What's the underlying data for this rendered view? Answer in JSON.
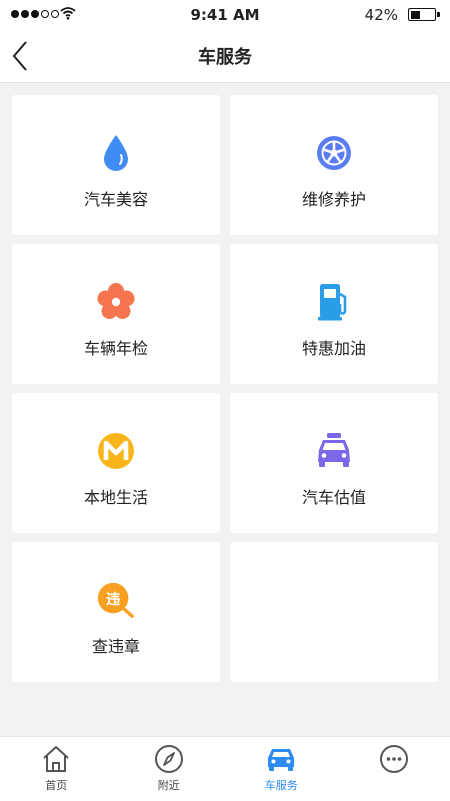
{
  "status_bar": {
    "time": "9:41 AM",
    "battery": "42%",
    "battery_level": 0.42,
    "signal_bars": 3,
    "icons": [
      "signal-icon",
      "wifi-icon",
      "battery-icon"
    ]
  },
  "nav": {
    "title": "车服务",
    "back_icon": "chevron-left-icon"
  },
  "services": [
    {
      "label": "汽车美容",
      "icon": "water-drop-icon",
      "color": "#3f8cf3"
    },
    {
      "label": "维修养护",
      "icon": "wheel-icon",
      "color": "#5b7df2"
    },
    {
      "label": "车辆年检",
      "icon": "flower-icon",
      "color": "#f5754f"
    },
    {
      "label": "特惠加油",
      "icon": "fuel-pump-icon",
      "color": "#2a9de8"
    },
    {
      "label": "本地生活",
      "icon": "m-badge-icon",
      "color": "#f9b51b"
    },
    {
      "label": "汽车估值",
      "icon": "car-icon",
      "color": "#7a68e8"
    },
    {
      "label": "查违章",
      "icon": "violation-search-icon",
      "color": "#f8a021",
      "badge": "违"
    }
  ],
  "tabs": [
    {
      "label": "首页",
      "icon": "home-icon",
      "active": false
    },
    {
      "label": "附近",
      "icon": "compass-icon",
      "active": false
    },
    {
      "label": "车服务",
      "icon": "car-icon",
      "active": true
    },
    {
      "label": "",
      "icon": "more-icon",
      "active": false
    }
  ],
  "colors": {
    "accent": "#2d8cf0",
    "background": "#f2f2f2",
    "tile": "#ffffff"
  }
}
